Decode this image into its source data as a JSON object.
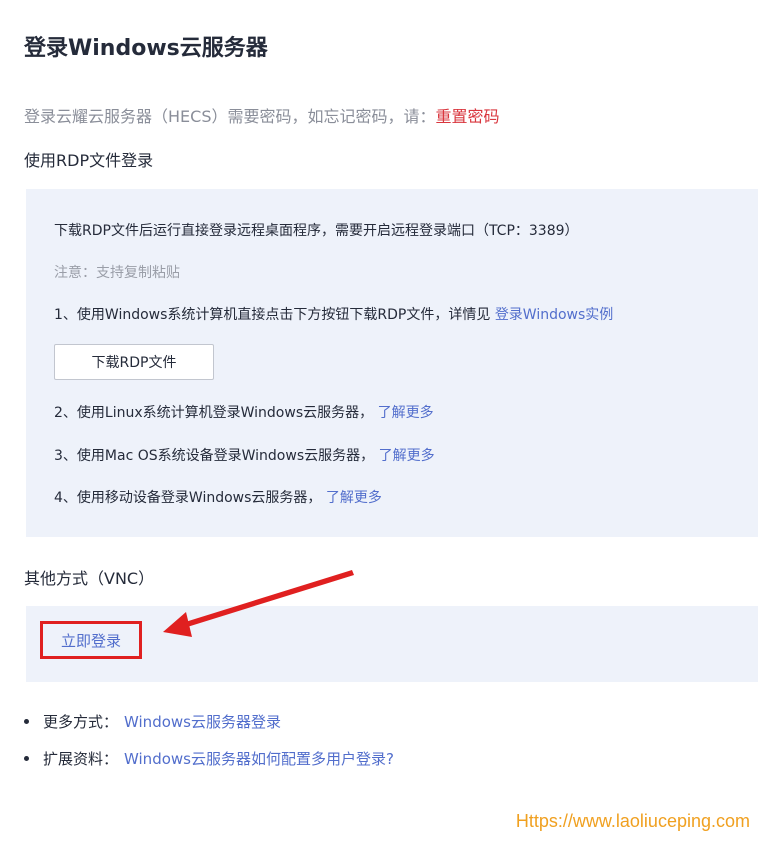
{
  "page": {
    "title": "登录Windows云服务器",
    "intro_text": "登录云耀云服务器（HECS）需要密码，如忘记密码，请：",
    "reset_password_link": "重置密码"
  },
  "rdp_section": {
    "heading": "使用RDP文件登录",
    "description": "下载RDP文件后运行直接登录远程桌面程序，需要开启远程登录端口（TCP：3389）",
    "note": "注意：支持复制粘贴",
    "step1_text": "1、使用Windows系统计算机直接点击下方按钮下载RDP文件，详情见 ",
    "step1_link": "登录Windows实例",
    "download_button": "下载RDP文件",
    "step2_text": "2、使用Linux系统计算机登录Windows云服务器， ",
    "step2_link": "了解更多",
    "step3_text": "3、使用Mac OS系统设备登录Windows云服务器， ",
    "step3_link": "了解更多",
    "step4_text": "4、使用移动设备登录Windows云服务器， ",
    "step4_link": "了解更多"
  },
  "vnc_section": {
    "heading": "其他方式（VNC）",
    "login_button": "立即登录"
  },
  "extras": [
    {
      "label": "更多方式：",
      "link": "Windows云服务器登录"
    },
    {
      "label": "扩展资料：",
      "link": "Windows云服务器如何配置多用户登录?"
    }
  ],
  "watermark": {
    "text": "Https://www.laoliuceping.com"
  },
  "colors": {
    "link": "#526ecc",
    "reset_link": "#d9363e",
    "panel_background": "#eef2fa",
    "highlight_box": "#e02020",
    "annotation_arrow": "#e02020",
    "watermark": "#f0a020"
  }
}
